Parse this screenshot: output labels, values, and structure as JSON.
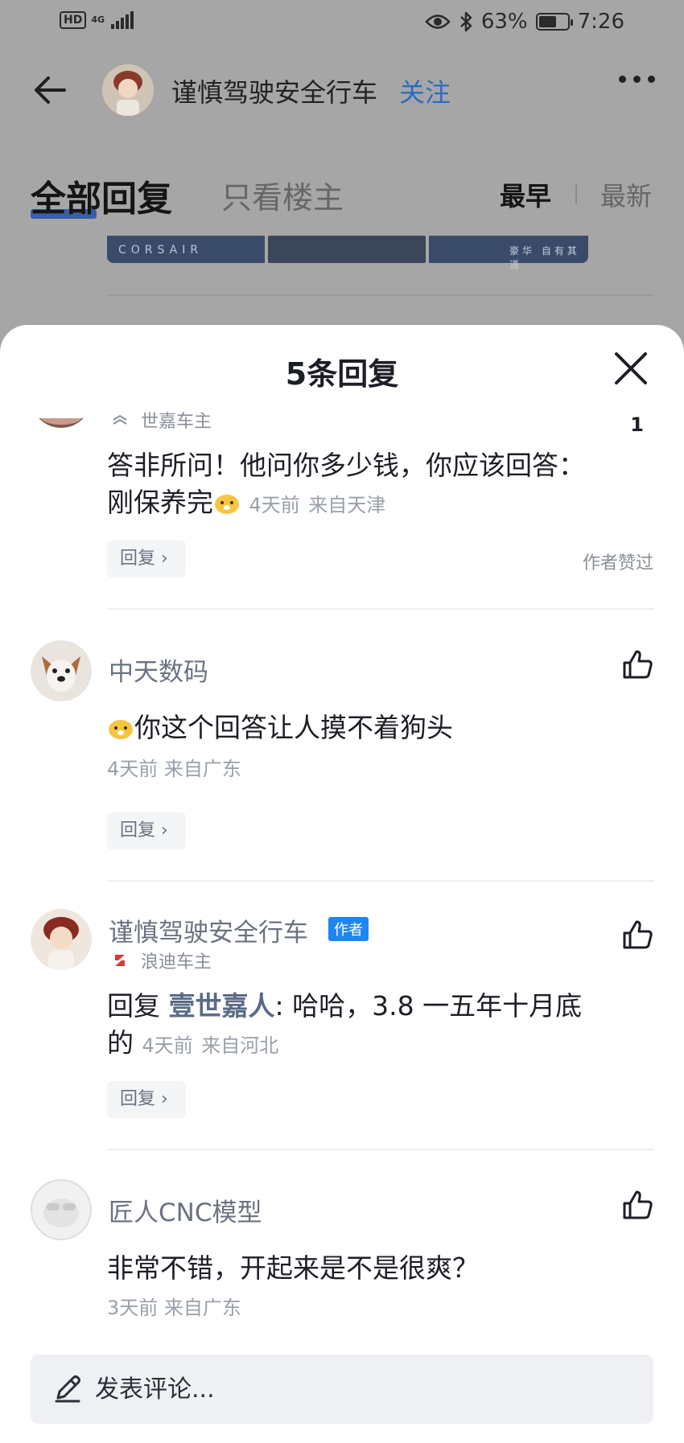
{
  "status_bar": {
    "hd": "HD",
    "network": "4G",
    "battery_percent": "63%",
    "battery_level": 0.63,
    "time": "7:26"
  },
  "header": {
    "author_name": "谨慎驾驶安全行车",
    "follow_label": "关注"
  },
  "tabs": {
    "all": "全部回复",
    "owner_only": "只看楼主"
  },
  "sort": {
    "earliest": "最早",
    "latest": "最新"
  },
  "banner": {
    "left_text": "CORSAIR",
    "right_text": "豪华 自有其道"
  },
  "sheet": {
    "title": "5条回复"
  },
  "replies": [
    {
      "car_owner": "世嘉车主",
      "content": "答非所问！他问你多少钱，你应该回答：刚保养完",
      "time": "4天前",
      "location": "来自天津",
      "reply_label": "回复",
      "like_count": "1",
      "author_liked": "作者赞过"
    },
    {
      "username": "中天数码",
      "content": "你这个回答让人摸不着狗头",
      "time": "4天前",
      "location": "来自广东",
      "reply_label": "回复"
    },
    {
      "username": "谨慎驾驶安全行车",
      "badge": "作者",
      "car_owner": "浪迪车主",
      "reply_prefix": "回复",
      "mention": "壹世嘉人",
      "content": ": 哈哈，3.8  一五年十月底的",
      "time": "4天前",
      "location": "来自河北",
      "reply_label": "回复"
    },
    {
      "username": "匠人CNC模型",
      "content": "非常不错，开起来是不是很爽？",
      "time": "3天前",
      "location": "来自广东"
    }
  ],
  "comment_bar": {
    "placeholder": "发表评论..."
  },
  "colors": {
    "accent_blue": "#1f86f0",
    "follow_blue": "#2b6dbf",
    "author_badge": "#1f86f0"
  },
  "icons": [
    "back-arrow-icon",
    "more-icon",
    "close-icon",
    "thumbs-up-icon",
    "chevron-right-icon",
    "pencil-icon",
    "eye-icon",
    "bluetooth-icon",
    "battery-icon",
    "signal-icon"
  ]
}
